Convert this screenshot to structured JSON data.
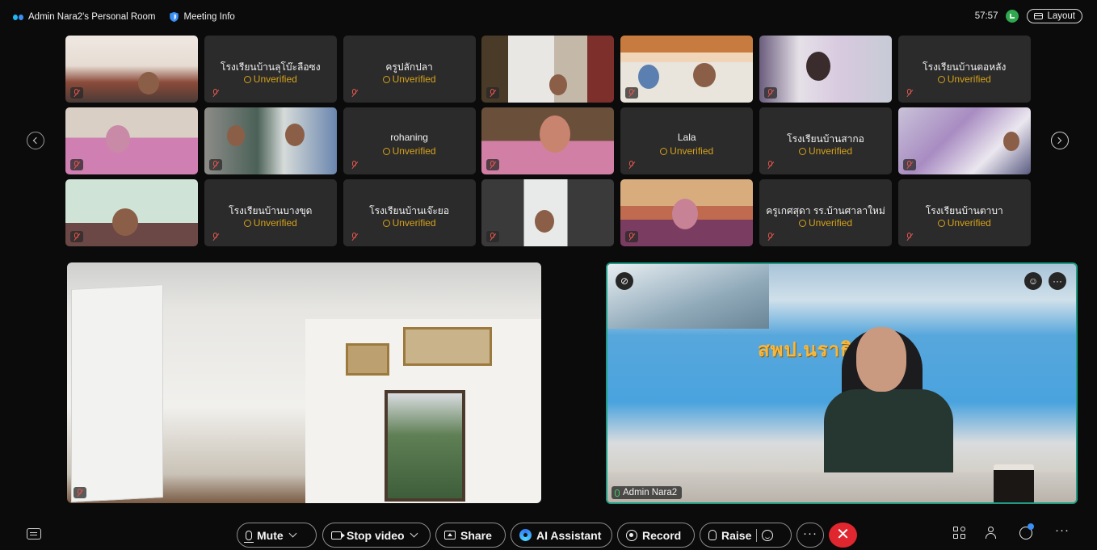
{
  "header": {
    "room_title": "Admin Nara2's Personal Room",
    "meeting_info": "Meeting Info",
    "timer": "57:57",
    "layout_label": "Layout"
  },
  "tiles": [
    {
      "name": "",
      "unverified": ""
    },
    {
      "name": "โรงเรียนบ้านลุโบ๊ะลือซง",
      "unverified": "Unverified"
    },
    {
      "name": "ครูปลักปลา",
      "unverified": "Unverified"
    },
    {
      "name": "",
      "unverified": ""
    },
    {
      "name": "",
      "unverified": ""
    },
    {
      "name": "",
      "unverified": ""
    },
    {
      "name": "โรงเรียนบ้านตอหลัง",
      "unverified": "Unverified"
    },
    {
      "name": "",
      "unverified": ""
    },
    {
      "name": "",
      "unverified": ""
    },
    {
      "name": "rohaning",
      "unverified": "Unverified"
    },
    {
      "name": "",
      "unverified": ""
    },
    {
      "name": "Lala",
      "unverified": "Unverified"
    },
    {
      "name": "โรงเรียนบ้านสากอ",
      "unverified": "Unverified"
    },
    {
      "name": "",
      "unverified": ""
    },
    {
      "name": "",
      "unverified": ""
    },
    {
      "name": "โรงเรียนบ้านบางขุด",
      "unverified": "Unverified"
    },
    {
      "name": "โรงเรียนบ้านเจ๊ะยอ",
      "unverified": "Unverified"
    },
    {
      "name": "",
      "unverified": ""
    },
    {
      "name": "",
      "unverified": ""
    },
    {
      "name": "ครูเกศสุดา รร.บ้านศาลาใหม่",
      "unverified": "Unverified"
    },
    {
      "name": "โรงเรียนบ้านตาบา",
      "unverified": "Unverified"
    }
  ],
  "stage": {
    "speaker_name": "Admin Nara2",
    "banner_text": "สพป.นราธิว   ต ๒"
  },
  "controls": {
    "mute": "Mute",
    "stop_video": "Stop video",
    "share": "Share",
    "ai_assistant": "AI Assistant",
    "record": "Record",
    "raise": "Raise",
    "more": "···",
    "leave": "✕",
    "overflow": "···"
  },
  "colors": {
    "unverified": "#d6a21a",
    "active_speaker_border": "#1f9d84",
    "leave": "#e0262f",
    "muted_icon": "#e0554d"
  },
  "icons": [
    "webex-logo-icon",
    "shield-icon",
    "signal-icon",
    "layout-icon",
    "mic-muted-icon",
    "chevron-left-icon",
    "chevron-right-icon",
    "pin-icon",
    "reaction-icon",
    "more-icon",
    "closed-captions-icon",
    "mic-icon",
    "camera-icon",
    "share-screen-icon",
    "ai-assistant-icon",
    "record-icon",
    "raise-hand-icon",
    "emoji-icon",
    "hangup-icon",
    "apps-icon",
    "participants-icon",
    "chat-icon"
  ]
}
